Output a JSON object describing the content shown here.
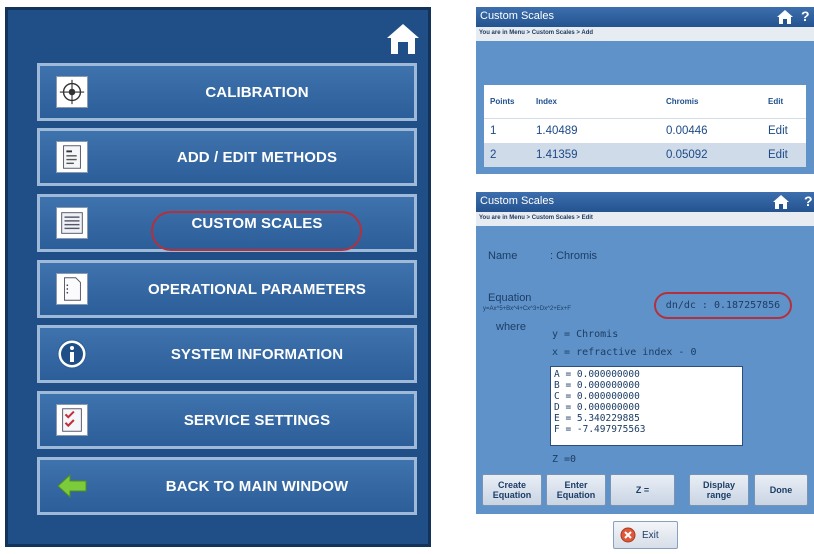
{
  "menu": {
    "items": [
      {
        "label": "CALIBRATION",
        "icon": "crosshair-icon"
      },
      {
        "label": "ADD / EDIT METHODS",
        "icon": "document-icon"
      },
      {
        "label": "CUSTOM SCALES",
        "icon": "scale-list-icon"
      },
      {
        "label": "OPERATIONAL PARAMETERS",
        "icon": "page-icon"
      },
      {
        "label": "SYSTEM INFORMATION",
        "icon": "info-icon"
      },
      {
        "label": "SERVICE SETTINGS",
        "icon": "checklist-icon"
      },
      {
        "label": "BACK TO MAIN WINDOW",
        "icon": "arrow-left-icon"
      }
    ],
    "highlighted": "CUSTOM SCALES"
  },
  "add_window": {
    "title": "Custom Scales",
    "help": "?",
    "breadcrumb": "You are in Menu > Custom Scales > Add",
    "table": {
      "headers": [
        "Points",
        "Index",
        "Chromis",
        "Edit"
      ],
      "rows": [
        [
          "1",
          "1.40489",
          "0.00446",
          "Edit"
        ],
        [
          "2",
          "1.41359",
          "0.05092",
          "Edit"
        ]
      ]
    }
  },
  "edit_window": {
    "title": "Custom Scales",
    "help": "?",
    "breadcrumb": "You are in Menu > Custom Scales > Edit",
    "name_label": "Name",
    "name_value": ": Chromis",
    "equation_label": "Equation",
    "equation_formula": "y=Ax^5+Bx^4+Cx^3+Dx^2+Ex+F",
    "dndc": "dn/dc : 0.187257856",
    "where_label": "where",
    "y_def": "y = Chromis",
    "x_def": "x = refractive index - 0",
    "coefficients": [
      "A = 0.000000000",
      "B = 0.000000000",
      "C = 0.000000000",
      "D = 0.000000000",
      "E = 5.340229885",
      "F = -7.497975563"
    ],
    "z_value": "Z =0",
    "buttons": {
      "create_line1": "Create",
      "create_line2": "Equation",
      "enter_line1": "Enter",
      "enter_line2": "Equation",
      "z": "Z =",
      "display_line1": "Display",
      "display_line2": "range",
      "done": "Done"
    },
    "exit": "Exit"
  }
}
